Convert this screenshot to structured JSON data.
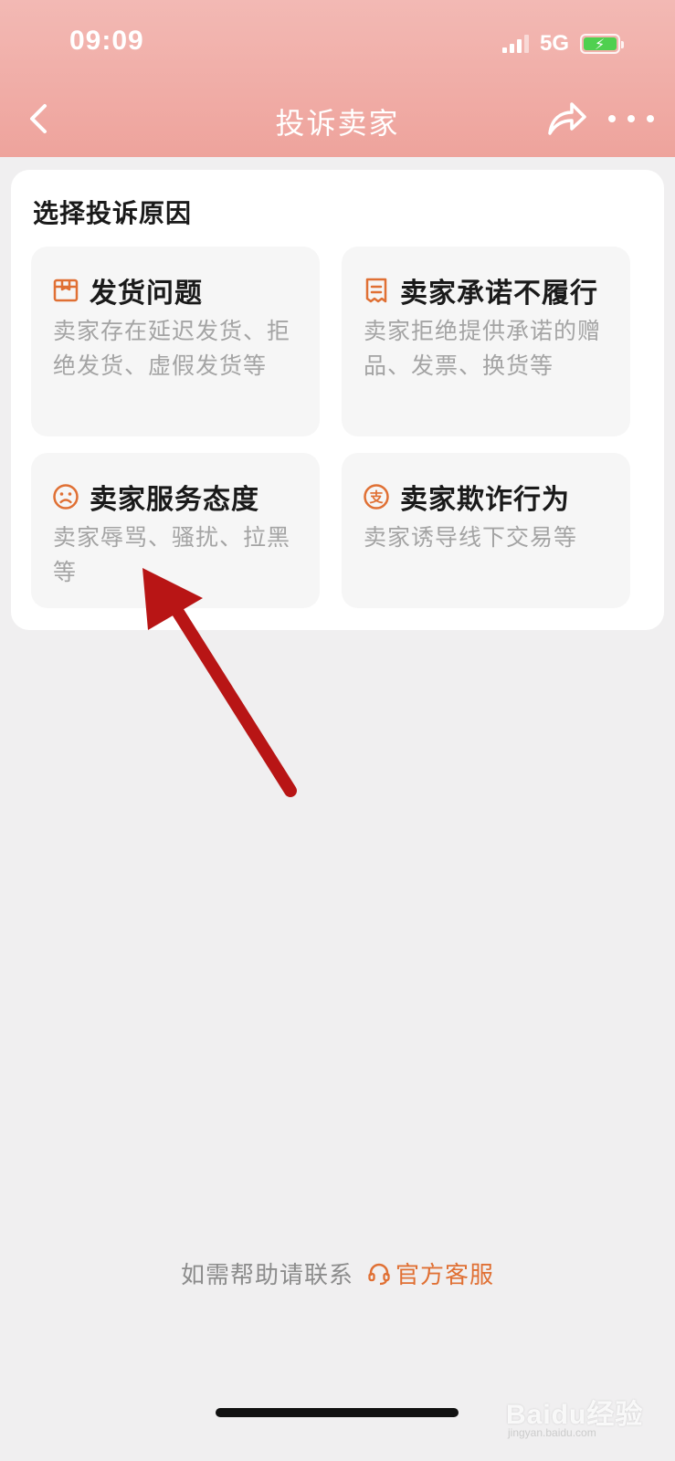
{
  "status_bar": {
    "time": "09:09",
    "network": "5G"
  },
  "nav": {
    "title": "投诉卖家"
  },
  "card": {
    "title": "选择投诉原因",
    "options": [
      {
        "title": "发货问题",
        "desc": "卖家存在延迟发货、拒绝发货、虚假发货等",
        "icon": "package-icon"
      },
      {
        "title": "卖家承诺不履行",
        "desc": "卖家拒绝提供承诺的赠品、发票、换货等",
        "icon": "receipt-icon"
      },
      {
        "title": "卖家服务态度",
        "desc": "卖家辱骂、骚扰、拉黑等",
        "icon": "sad-face-icon"
      },
      {
        "title": "卖家欺诈行为",
        "desc": "卖家诱导线下交易等",
        "icon": "pay-icon"
      }
    ]
  },
  "footer": {
    "text": "如需帮助请联系",
    "link": "官方客服"
  },
  "watermark": {
    "brand": "Baidu经验",
    "sub": "jingyan.baidu.com"
  },
  "colors": {
    "accent": "#e07034",
    "header": "#eea39c",
    "arrow": "#b81515"
  }
}
